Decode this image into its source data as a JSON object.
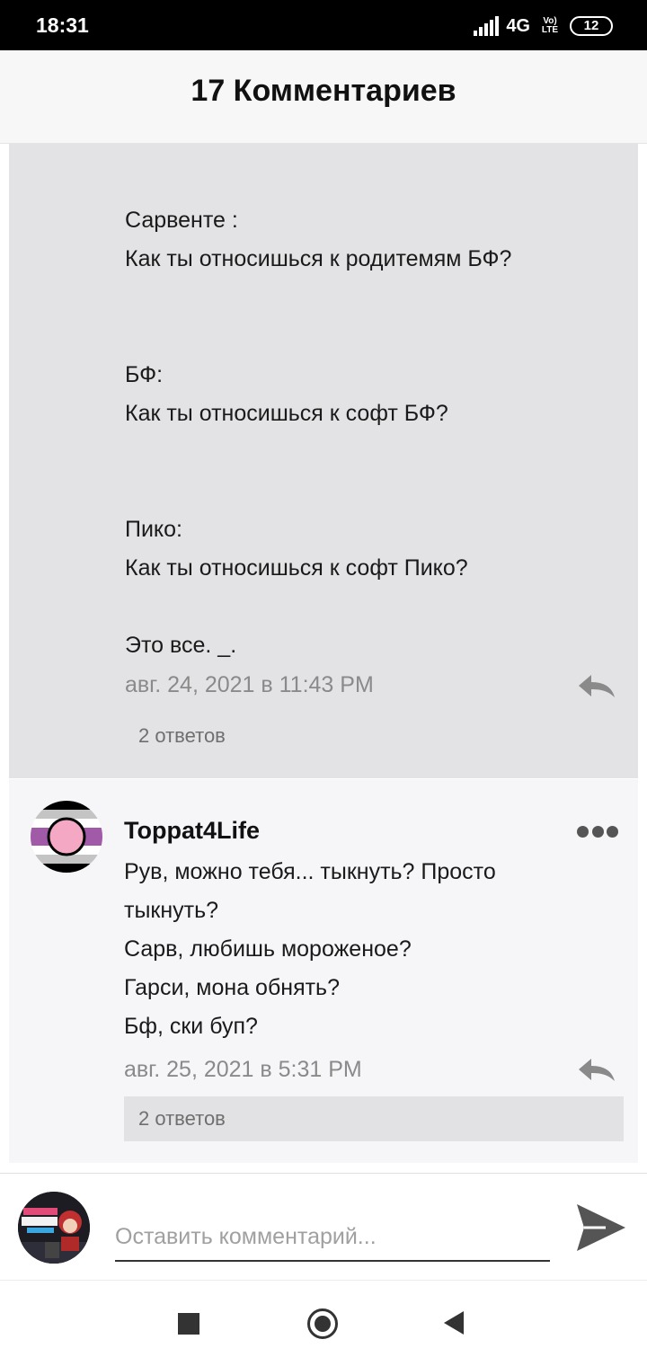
{
  "status_bar": {
    "time": "18:31",
    "network": "4G",
    "volte": "Vo) LTE",
    "battery": "12"
  },
  "header": {
    "title": "17 Комментариев"
  },
  "comments": [
    {
      "body_lines": [
        "Сарвенте :",
        "Как ты относишься к родитемям БФ?",
        "БФ:",
        "Как ты относишься к софт БФ?",
        "Пико:",
        "Как ты относишься к софт Пико?",
        "Это все. _."
      ],
      "timestamp": "авг. 24, 2021 в 11:43 PM",
      "replies": "2 ответов"
    },
    {
      "username": "Toppat4Life",
      "body_lines": [
        "Рув, можно тебя... тыкнуть? Просто",
        "тыкнуть?",
        "Сарв, любишь мороженое?",
        "Гарси, мона обнять?",
        "Бф, ски буп?"
      ],
      "timestamp": "авг. 25, 2021 в 5:31 PM",
      "replies": "2 ответов"
    }
  ],
  "composer": {
    "placeholder": "Оставить комментарий..."
  },
  "colors": {
    "highlight_bg": "#e3e3e5",
    "comment_bg": "#f6f5f8",
    "avatar_flag": [
      "#000000",
      "#c4c4c4",
      "#ffffff",
      "#ffffff",
      "#a05aa8",
      "#ffffff",
      "#c4c4c4",
      "#000000"
    ],
    "avatar_dot": "#f5a8c4"
  }
}
